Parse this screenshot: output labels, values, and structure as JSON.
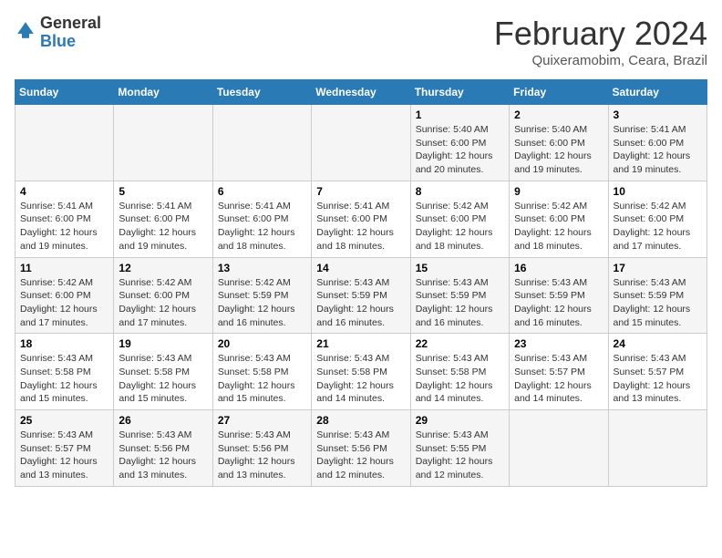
{
  "header": {
    "logo_general": "General",
    "logo_blue": "Blue",
    "title": "February 2024",
    "subtitle": "Quixeramobim, Ceara, Brazil"
  },
  "days_of_week": [
    "Sunday",
    "Monday",
    "Tuesday",
    "Wednesday",
    "Thursday",
    "Friday",
    "Saturday"
  ],
  "weeks": [
    [
      {
        "day": "",
        "detail": ""
      },
      {
        "day": "",
        "detail": ""
      },
      {
        "day": "",
        "detail": ""
      },
      {
        "day": "",
        "detail": ""
      },
      {
        "day": "1",
        "detail": "Sunrise: 5:40 AM\nSunset: 6:00 PM\nDaylight: 12 hours\nand 20 minutes."
      },
      {
        "day": "2",
        "detail": "Sunrise: 5:40 AM\nSunset: 6:00 PM\nDaylight: 12 hours\nand 19 minutes."
      },
      {
        "day": "3",
        "detail": "Sunrise: 5:41 AM\nSunset: 6:00 PM\nDaylight: 12 hours\nand 19 minutes."
      }
    ],
    [
      {
        "day": "4",
        "detail": "Sunrise: 5:41 AM\nSunset: 6:00 PM\nDaylight: 12 hours\nand 19 minutes."
      },
      {
        "day": "5",
        "detail": "Sunrise: 5:41 AM\nSunset: 6:00 PM\nDaylight: 12 hours\nand 19 minutes."
      },
      {
        "day": "6",
        "detail": "Sunrise: 5:41 AM\nSunset: 6:00 PM\nDaylight: 12 hours\nand 18 minutes."
      },
      {
        "day": "7",
        "detail": "Sunrise: 5:41 AM\nSunset: 6:00 PM\nDaylight: 12 hours\nand 18 minutes."
      },
      {
        "day": "8",
        "detail": "Sunrise: 5:42 AM\nSunset: 6:00 PM\nDaylight: 12 hours\nand 18 minutes."
      },
      {
        "day": "9",
        "detail": "Sunrise: 5:42 AM\nSunset: 6:00 PM\nDaylight: 12 hours\nand 18 minutes."
      },
      {
        "day": "10",
        "detail": "Sunrise: 5:42 AM\nSunset: 6:00 PM\nDaylight: 12 hours\nand 17 minutes."
      }
    ],
    [
      {
        "day": "11",
        "detail": "Sunrise: 5:42 AM\nSunset: 6:00 PM\nDaylight: 12 hours\nand 17 minutes."
      },
      {
        "day": "12",
        "detail": "Sunrise: 5:42 AM\nSunset: 6:00 PM\nDaylight: 12 hours\nand 17 minutes."
      },
      {
        "day": "13",
        "detail": "Sunrise: 5:42 AM\nSunset: 5:59 PM\nDaylight: 12 hours\nand 16 minutes."
      },
      {
        "day": "14",
        "detail": "Sunrise: 5:43 AM\nSunset: 5:59 PM\nDaylight: 12 hours\nand 16 minutes."
      },
      {
        "day": "15",
        "detail": "Sunrise: 5:43 AM\nSunset: 5:59 PM\nDaylight: 12 hours\nand 16 minutes."
      },
      {
        "day": "16",
        "detail": "Sunrise: 5:43 AM\nSunset: 5:59 PM\nDaylight: 12 hours\nand 16 minutes."
      },
      {
        "day": "17",
        "detail": "Sunrise: 5:43 AM\nSunset: 5:59 PM\nDaylight: 12 hours\nand 15 minutes."
      }
    ],
    [
      {
        "day": "18",
        "detail": "Sunrise: 5:43 AM\nSunset: 5:58 PM\nDaylight: 12 hours\nand 15 minutes."
      },
      {
        "day": "19",
        "detail": "Sunrise: 5:43 AM\nSunset: 5:58 PM\nDaylight: 12 hours\nand 15 minutes."
      },
      {
        "day": "20",
        "detail": "Sunrise: 5:43 AM\nSunset: 5:58 PM\nDaylight: 12 hours\nand 15 minutes."
      },
      {
        "day": "21",
        "detail": "Sunrise: 5:43 AM\nSunset: 5:58 PM\nDaylight: 12 hours\nand 14 minutes."
      },
      {
        "day": "22",
        "detail": "Sunrise: 5:43 AM\nSunset: 5:58 PM\nDaylight: 12 hours\nand 14 minutes."
      },
      {
        "day": "23",
        "detail": "Sunrise: 5:43 AM\nSunset: 5:57 PM\nDaylight: 12 hours\nand 14 minutes."
      },
      {
        "day": "24",
        "detail": "Sunrise: 5:43 AM\nSunset: 5:57 PM\nDaylight: 12 hours\nand 13 minutes."
      }
    ],
    [
      {
        "day": "25",
        "detail": "Sunrise: 5:43 AM\nSunset: 5:57 PM\nDaylight: 12 hours\nand 13 minutes."
      },
      {
        "day": "26",
        "detail": "Sunrise: 5:43 AM\nSunset: 5:56 PM\nDaylight: 12 hours\nand 13 minutes."
      },
      {
        "day": "27",
        "detail": "Sunrise: 5:43 AM\nSunset: 5:56 PM\nDaylight: 12 hours\nand 13 minutes."
      },
      {
        "day": "28",
        "detail": "Sunrise: 5:43 AM\nSunset: 5:56 PM\nDaylight: 12 hours\nand 12 minutes."
      },
      {
        "day": "29",
        "detail": "Sunrise: 5:43 AM\nSunset: 5:55 PM\nDaylight: 12 hours\nand 12 minutes."
      },
      {
        "day": "",
        "detail": ""
      },
      {
        "day": "",
        "detail": ""
      }
    ]
  ]
}
